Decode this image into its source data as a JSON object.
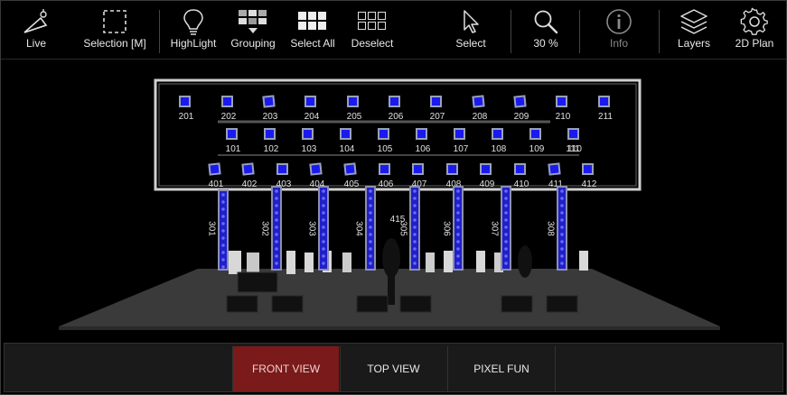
{
  "toolbar": {
    "live": "Live",
    "selection": "Selection [M]",
    "highlight": "HighLight",
    "grouping": "Grouping",
    "select_all": "Select All",
    "deselect": "Deselect",
    "select": "Select",
    "zoom": "30 %",
    "info": "Info",
    "layers": "Layers",
    "plan": "2D Plan"
  },
  "stage": {
    "row_top": [
      "201",
      "202",
      "203",
      "204",
      "205",
      "206",
      "207",
      "208",
      "209",
      "210",
      "211"
    ],
    "row_mid": [
      "101",
      "102",
      "103",
      "104",
      "105",
      "106",
      "107",
      "108",
      "109",
      "110",
      "111"
    ],
    "row_low": [
      "401",
      "402",
      "403",
      "404",
      "405",
      "406",
      "407",
      "408",
      "409",
      "410",
      "411",
      "412"
    ],
    "columns": [
      "301",
      "302",
      "303",
      "304",
      "305",
      "306",
      "307",
      "308"
    ],
    "extra_label": "415"
  },
  "tabs": {
    "front": "FRONT VIEW",
    "top": "TOP VIEW",
    "pixel": "PIXEL FUN"
  },
  "colors": {
    "fixture": "#1a1aee",
    "active_tab": "#7a1a1a"
  }
}
